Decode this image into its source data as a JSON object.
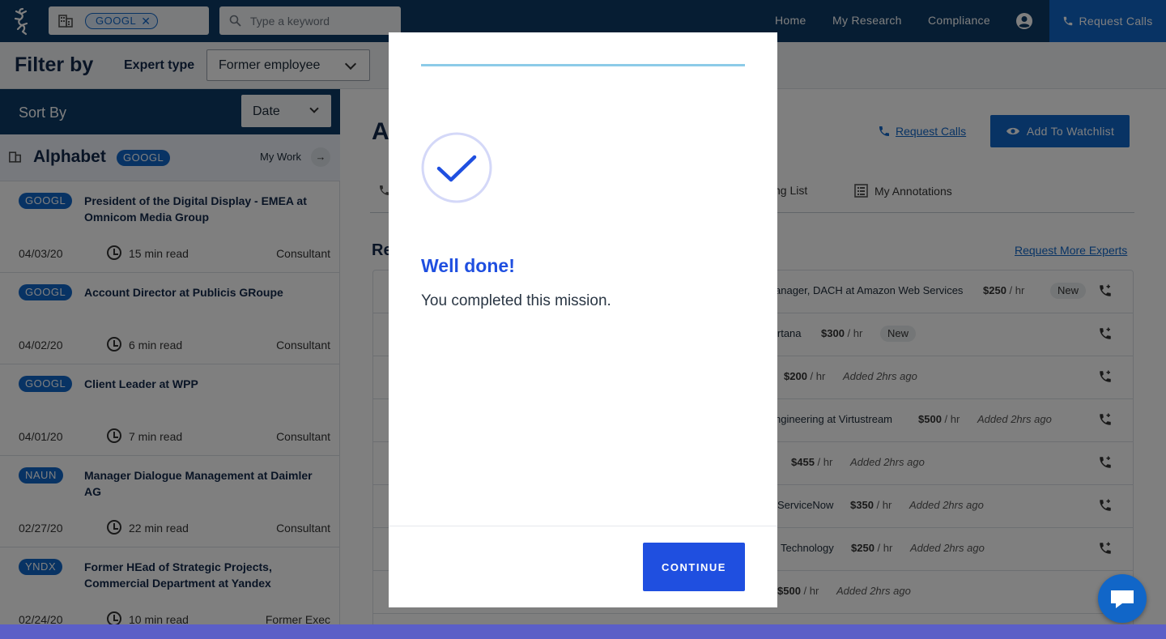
{
  "topnav": {
    "company_chip": "GOOGL",
    "search_placeholder": "Type a keyword",
    "links": [
      "Home",
      "My Research",
      "Compliance"
    ],
    "request_calls": "Request Calls"
  },
  "filter": {
    "title": "Filter by",
    "expert_type_label": "Expert type",
    "expert_type_value": "Former employee"
  },
  "sidebar": {
    "sort_title": "Sort By",
    "sort_value": "Date",
    "company": {
      "name": "Alphabet",
      "ticker": "GOOGL",
      "my_work": "My Work"
    },
    "articles": [
      {
        "ticker": "GOOGL",
        "title": "President of the Digital Display - EMEA at Omnicom Media Group",
        "date": "04/03/20",
        "read": "15 min read",
        "type": "Consultant"
      },
      {
        "ticker": "GOOGL",
        "title": "Account Director at Publicis GRoupe",
        "date": "04/02/20",
        "read": "6 min read",
        "type": "Consultant"
      },
      {
        "ticker": "GOOGL",
        "title": "Client Leader at WPP",
        "date": "04/01/20",
        "read": "7 min read",
        "type": "Consultant"
      },
      {
        "ticker": "NAUN",
        "title": "Manager Dialogue Management at Daimler AG",
        "date": "02/27/20",
        "read": "22 min read",
        "type": "Consultant"
      },
      {
        "ticker": "YNDX",
        "title": "Former HEad of Strategic Projects, Commercial Department at Yandex",
        "date": "02/24/20",
        "read": "10 min read",
        "type": "Former Exec"
      }
    ]
  },
  "main": {
    "title_initial": "A",
    "request_calls": "Request Calls",
    "add_watchlist": "Add To Watchlist",
    "tabs": [
      "ng List",
      "My Annotations"
    ],
    "section_initial": "Re",
    "request_more": "Request More Experts",
    "experts": [
      {
        "title": "anager, DACH at Amazon Web Services",
        "rate": "$250",
        "unit": " / hr",
        "status": "New"
      },
      {
        "title": "irtana",
        "rate": "$300",
        "unit": " / hr",
        "status": "New"
      },
      {
        "title": "",
        "rate": "$200",
        "unit": " / hr",
        "status": "Added 2hrs ago"
      },
      {
        "title": "ngineering at Virtustream",
        "rate": "$500",
        "unit": " / hr",
        "status": "Added 2hrs ago"
      },
      {
        "title": "",
        "rate": "$455",
        "unit": " / hr",
        "status": "Added 2hrs ago"
      },
      {
        "title": "ServiceNow",
        "rate": "$350",
        "unit": " / hr",
        "status": "Added 2hrs ago"
      },
      {
        "title": "Technology",
        "rate": "$250",
        "unit": " / hr",
        "status": "Added 2hrs ago"
      },
      {
        "title": "",
        "rate": "$500",
        "unit": " / hr",
        "status": "Added 2hrs ago"
      }
    ]
  },
  "modal": {
    "heading": "Well done!",
    "message": "You completed this mission.",
    "continue": "CONTINUE"
  },
  "colors": {
    "nav": "#0d3a66",
    "accent": "#1166c8",
    "modal_accent": "#1f4fe0",
    "progress": "#8ccbe8"
  }
}
